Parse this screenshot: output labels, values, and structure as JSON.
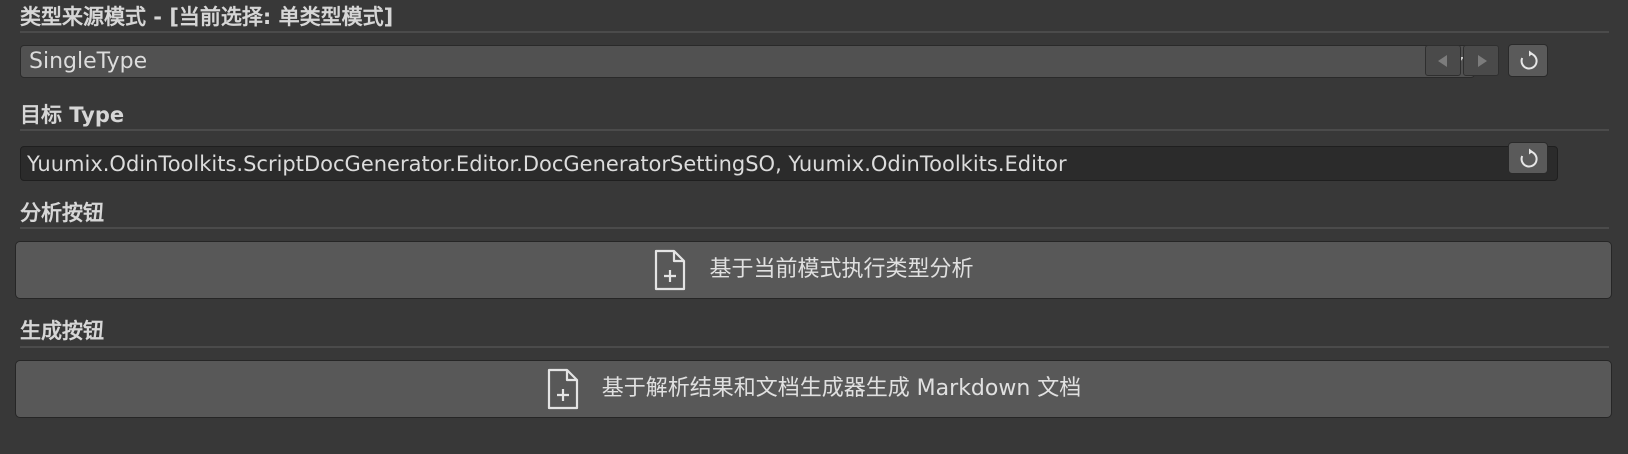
{
  "source_mode": {
    "title": "类型来源模式 - [当前选择: 单类型模式]",
    "dropdown_value": "SingleType",
    "icons": {
      "dropdown": "chevron-down-icon",
      "prev": "arrow-left-icon",
      "next": "arrow-right-icon",
      "refresh": "refresh-icon"
    }
  },
  "target_type": {
    "title": "目标 Type",
    "value": "Yuumix.OdinToolkits.ScriptDocGenerator.Editor.DocGeneratorSettingSO, Yuumix.OdinToolkits.Editor",
    "icons": {
      "dropdown": "caret-down-icon",
      "refresh": "refresh-icon"
    }
  },
  "analysis": {
    "title": "分析按钮",
    "button_label": "基于当前模式执行类型分析",
    "icon": "file-add-icon"
  },
  "generate": {
    "title": "生成按钮",
    "button_label": "基于解析结果和文档生成器生成 Markdown 文档",
    "icon": "file-add-icon"
  },
  "colors": {
    "background": "#383838",
    "button": "#585858",
    "field_dark": "#2b2b2b",
    "text": "#d6d6d6"
  }
}
